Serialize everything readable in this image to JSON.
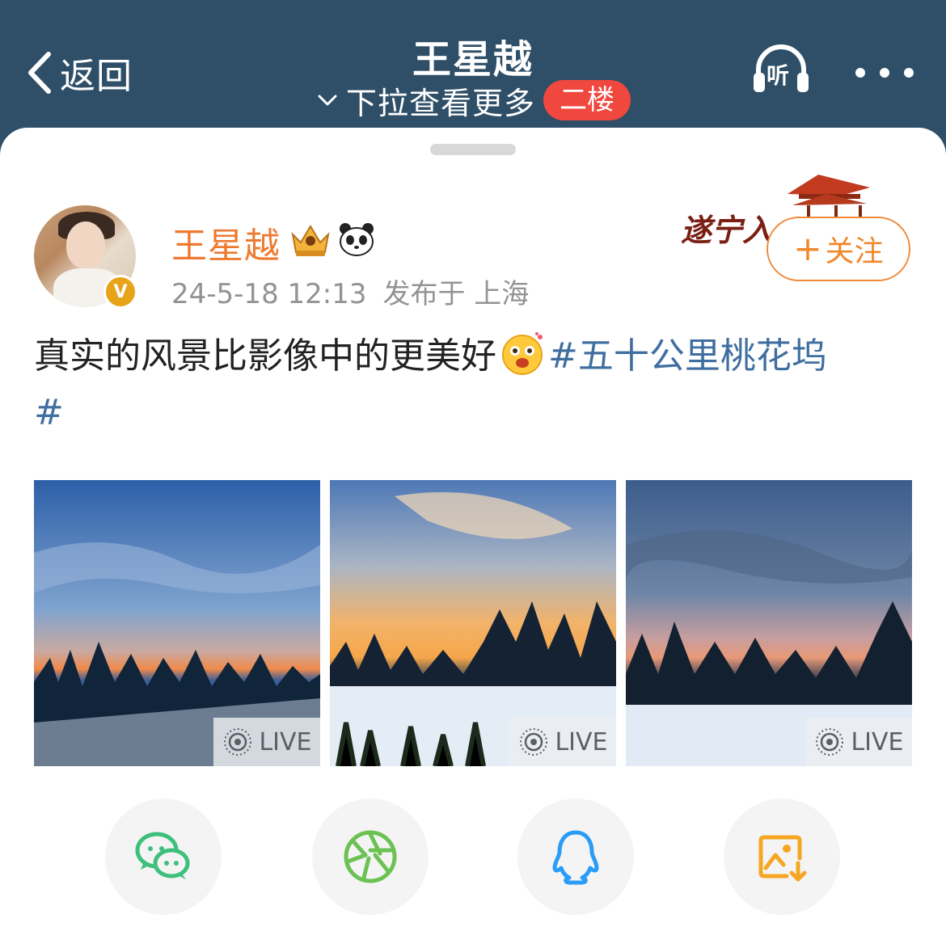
{
  "header": {
    "back_label": "返回",
    "title": "王星越",
    "pull_hint": "下拉查看更多",
    "floor_badge": "二楼",
    "listen_label": "听",
    "colors": {
      "bar": "#2e4f67",
      "badge": "#f0473f"
    }
  },
  "post": {
    "author": {
      "name": "王星越",
      "verified_badge": "V",
      "icons": [
        "crown-badge-icon",
        "panda-icon"
      ]
    },
    "date": "24-5-18 12:13",
    "location": "发布于 上海",
    "decor_text": "遂宁入",
    "follow_label": "关注",
    "follow_plus": "+",
    "text": "真实的风景比影像中的更美好",
    "emoji": "excited-face-emoji",
    "hashtag": "#五十公里桃花坞",
    "hashtag_end": "#",
    "photos": [
      {
        "live_label": "LIVE",
        "scene": "sunset-sky-forest-snow"
      },
      {
        "live_label": "LIVE",
        "scene": "golden-sunset-pines-snowfield"
      },
      {
        "live_label": "LIVE",
        "scene": "dusk-clouds-treeline-snow"
      }
    ]
  },
  "share_targets": [
    {
      "name": "WeChat",
      "icon": "wechat-icon",
      "color": "#3ec07c"
    },
    {
      "name": "Moments",
      "icon": "moments-icon",
      "color": "#6bc152"
    },
    {
      "name": "QQ",
      "icon": "qq-icon",
      "color": "#2a9cf5"
    },
    {
      "name": "Save Image",
      "icon": "save-image-icon",
      "color": "#f5a623"
    }
  ]
}
